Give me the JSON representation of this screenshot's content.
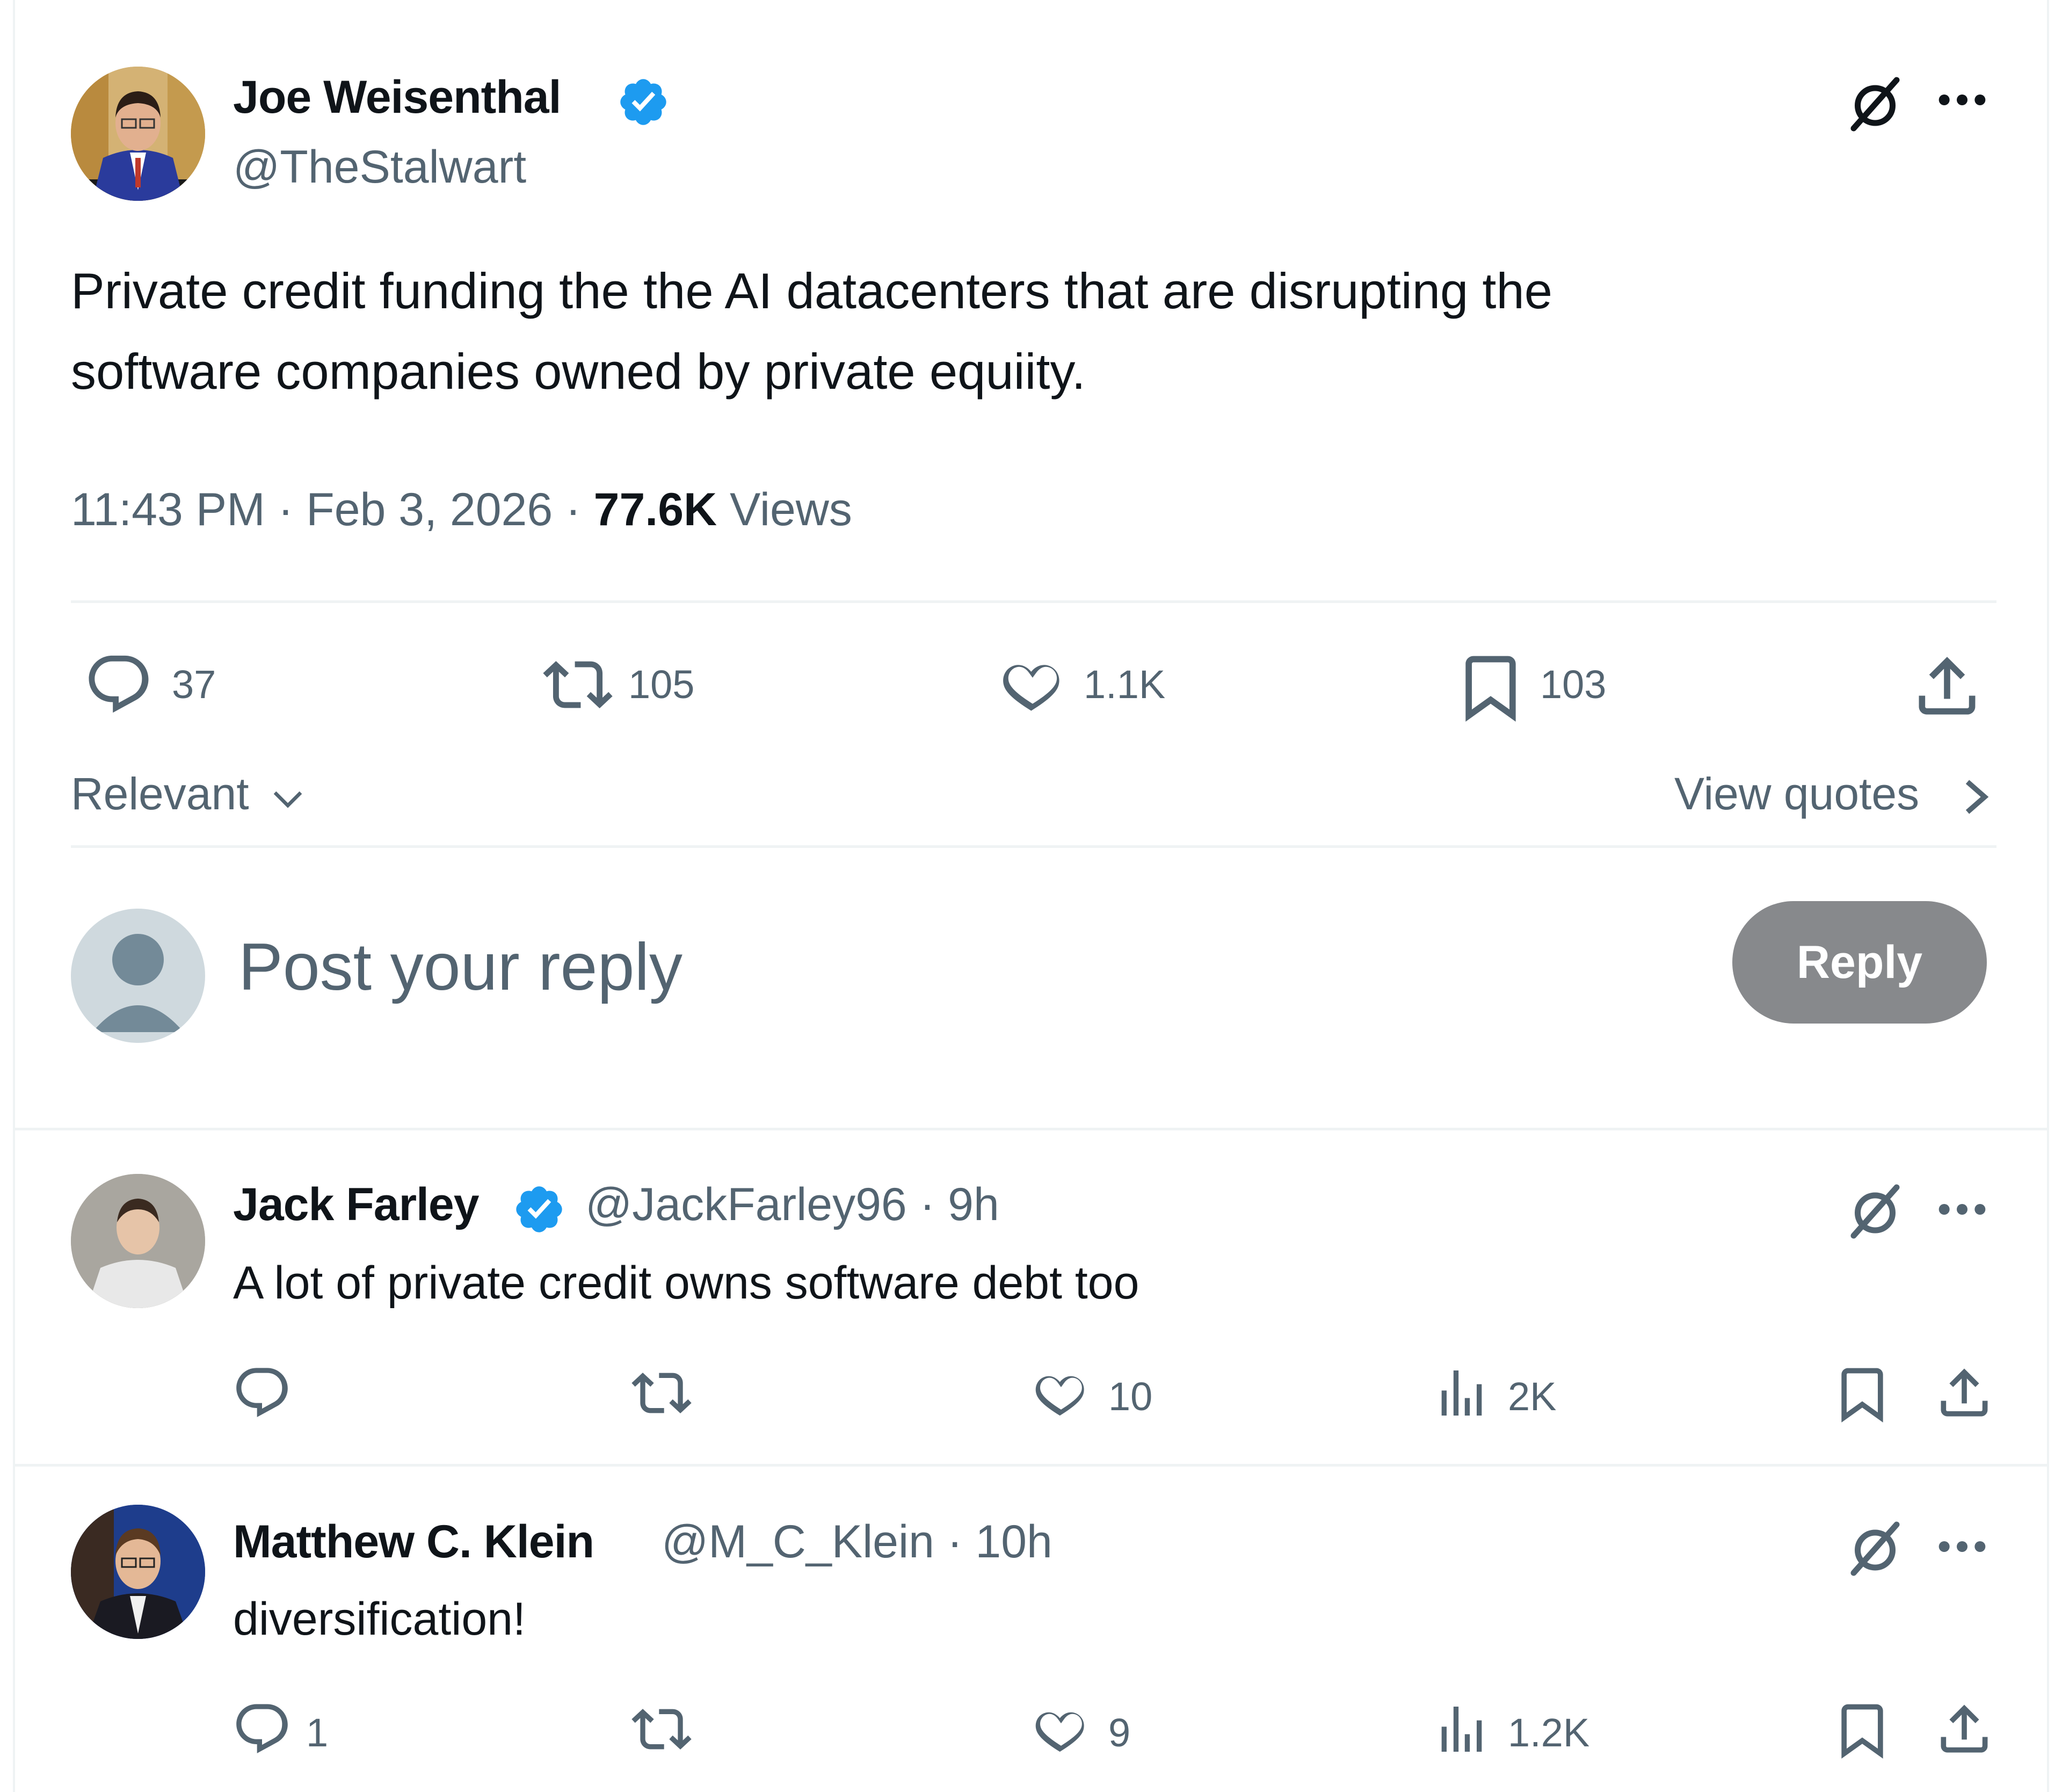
{
  "tweet": {
    "author_name": "Joe Weisenthal",
    "author_handle": "@TheStalwart",
    "text_line1": "Private credit funding the the AI datacenters that are disrupting the",
    "text_line2": "software companies owned by private equiity.",
    "time": "11:43 PM",
    "date": "Feb 3, 2026",
    "views_count": "77.6K",
    "views_label": "Views",
    "replies": "37",
    "reposts": "105",
    "likes": "1.1K",
    "bookmarks": "103"
  },
  "sort": {
    "label": "Relevant",
    "view_quotes": "View quotes"
  },
  "composer": {
    "placeholder": "Post your reply",
    "button": "Reply"
  },
  "replies": [
    {
      "name": "Jack Farley",
      "handle": "@JackFarley96",
      "time": "9h",
      "text": "A lot of private credit owns software debt too",
      "reply_count": "",
      "likes": "10",
      "views": "2K"
    },
    {
      "name": "Matthew C. Klein",
      "handle": "@M_C_Klein",
      "time": "10h",
      "text": "diversification!",
      "reply_count": "1",
      "likes": "9",
      "views": "1.2K"
    }
  ],
  "colors": {
    "verified": "#1d9bf0",
    "text": "#0f1419",
    "muted": "#536471",
    "divider": "#eff3f4",
    "reply_button": "#87898c"
  },
  "icons": [
    "grok-icon",
    "more-icon",
    "verified-badge-icon",
    "reply-icon",
    "repost-icon",
    "like-icon",
    "bookmark-icon",
    "share-icon",
    "views-icon",
    "chevron-down-icon",
    "chevron-right-icon"
  ]
}
